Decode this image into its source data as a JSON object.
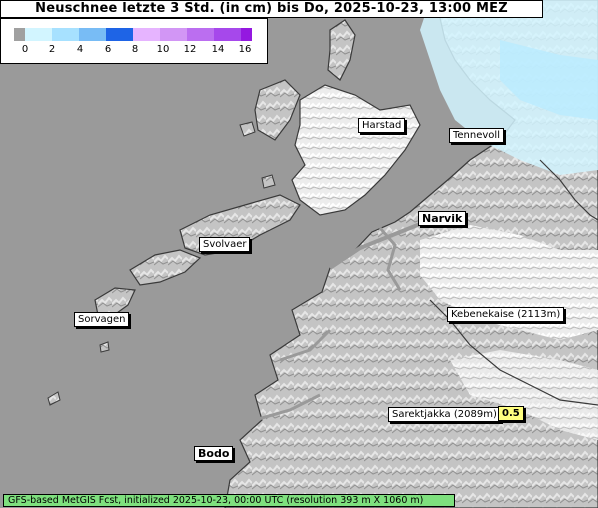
{
  "title": "Neuschnee letzte 3 Std. (in cm) bis Do, 2025-10-23, 13:00 MEZ",
  "legend": {
    "ticks": [
      "0",
      "2",
      "4",
      "6",
      "8",
      "10",
      "12",
      "14",
      "16"
    ],
    "colors": [
      "#a0a0a0",
      "#d2f5ff",
      "#a7e1ff",
      "#78bcf5",
      "#4a94ea",
      "#1e64e6",
      "#e6b4ff",
      "#d296f5",
      "#bb6ef0",
      "#a648eb",
      "#9418e0"
    ]
  },
  "places": [
    {
      "name": "Harstad",
      "bold": false
    },
    {
      "name": "Tennevoll",
      "bold": false
    },
    {
      "name": "Narvik",
      "bold": true
    },
    {
      "name": "Svolvaer",
      "bold": false
    },
    {
      "name": "Sorvagen",
      "bold": false
    },
    {
      "name": "Kebenekaise (2113m)",
      "bold": false
    },
    {
      "name": "Sarektjakka (2089m)",
      "bold": false,
      "value": "0.5"
    },
    {
      "name": "Bodo",
      "bold": true
    }
  ],
  "footer": "GFS-based MetGIS Fcst, initialized 2025-10-23, 00:00 UTC  (resolution 393 m X 1060 m)",
  "colors": {
    "sea": "#9a9a9a",
    "land": "#c8c8c8",
    "snow": "#f0f0f0",
    "light_snow": "#d2f5ff",
    "footer": "#7ee07e",
    "value_badge": "#ffff80"
  }
}
